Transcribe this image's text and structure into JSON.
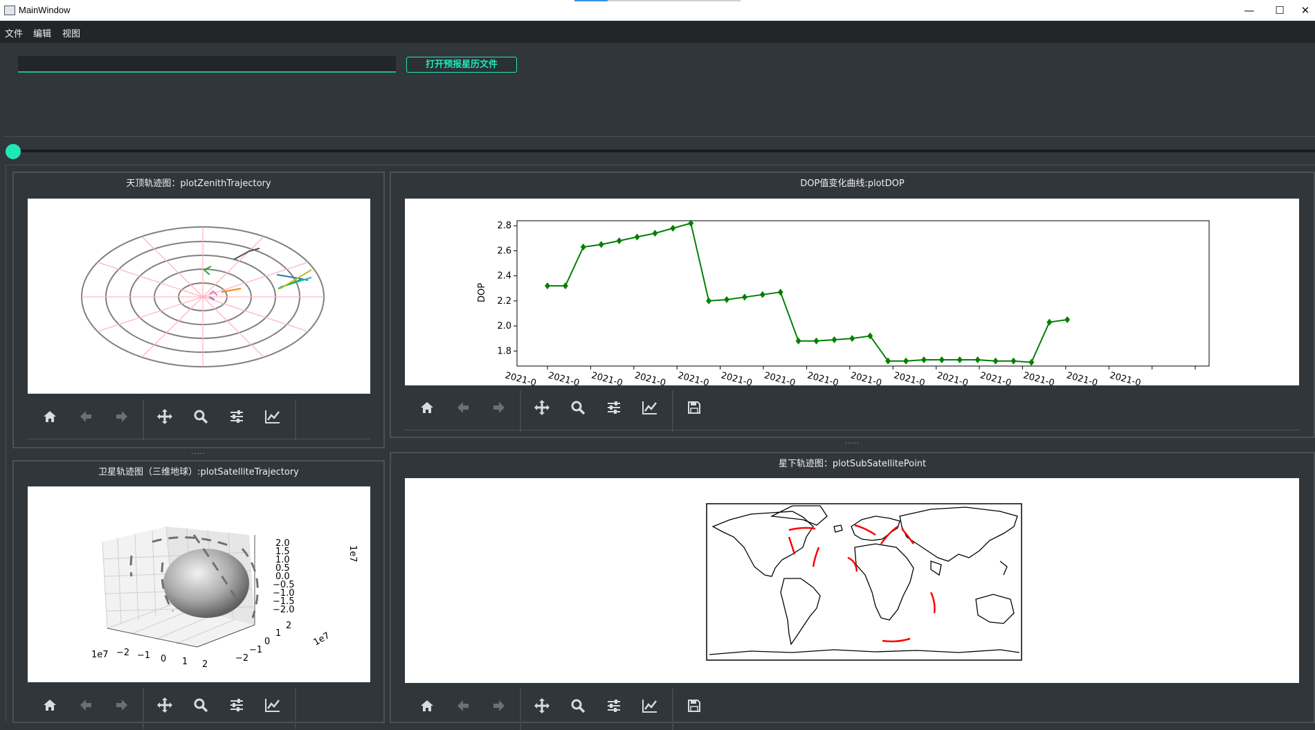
{
  "window": {
    "title": "MainWindow",
    "minimize_glyph": "—",
    "maximize_glyph": "☐",
    "close_glyph": "✕"
  },
  "menu": [
    "文件",
    "编辑",
    "视图"
  ],
  "file_input": {
    "value": "",
    "placeholder": ""
  },
  "open_button": {
    "label": "打开预报星历文件"
  },
  "slider": {
    "value": 0
  },
  "panels": {
    "zenith": {
      "title": "天顶轨迹图：plotZenithTrajectory"
    },
    "dop": {
      "title": "DOP值变化曲线:plotDOP"
    },
    "satellite3d": {
      "title": "卫星轨迹图（三维地球）:plotSatelliteTrajectory"
    },
    "subsatellite": {
      "title": "星下轨迹图：plotSubSatellitePoint"
    }
  },
  "splitter_glyph": ".....",
  "toolbar_icons": [
    "home-icon",
    "back-arrow-icon",
    "forward-arrow-icon",
    "pan-move-icon",
    "zoom-magnifier-icon",
    "configure-subplots-icon",
    "edit-axis-icon",
    "save-floppy-icon"
  ],
  "colors": {
    "accent": "#1de9b6",
    "background": "#31363b",
    "dop_line": "#008000",
    "ground_track": "#ff0000"
  },
  "chart_data": [
    {
      "type": "line",
      "title": "",
      "xlabel": "",
      "ylabel": "DOP",
      "x_tick_label": "2021-0",
      "yticks": [
        "1.8",
        "2.0",
        "2.2",
        "2.4",
        "2.6",
        "2.8"
      ],
      "ylim": [
        1.68,
        2.84
      ],
      "marker": "diamond",
      "series": [
        {
          "values": [
            2.32,
            2.32,
            2.63,
            2.65,
            2.68,
            2.71,
            2.74,
            2.78,
            2.82,
            2.2,
            2.21,
            2.23,
            2.25,
            2.27,
            1.88,
            1.88,
            1.89,
            1.9,
            1.92,
            1.72,
            1.72,
            1.73,
            1.73,
            1.73,
            1.73,
            1.72,
            1.72,
            1.71,
            2.03,
            2.05
          ]
        }
      ]
    },
    {
      "type": "scatter",
      "title": "",
      "axis_multiplier": "1e7",
      "x_ticks": [
        "−2",
        "−1",
        "0",
        "1",
        "2"
      ],
      "y_ticks": [
        "−2",
        "−1",
        "0",
        "1",
        "2"
      ],
      "z_ticks": [
        "2.0",
        "1.5",
        "1.0",
        "0.5",
        "0.0",
        "−0.5",
        "−1.0",
        "−1.5",
        "−2.0"
      ],
      "grid": true
    }
  ]
}
